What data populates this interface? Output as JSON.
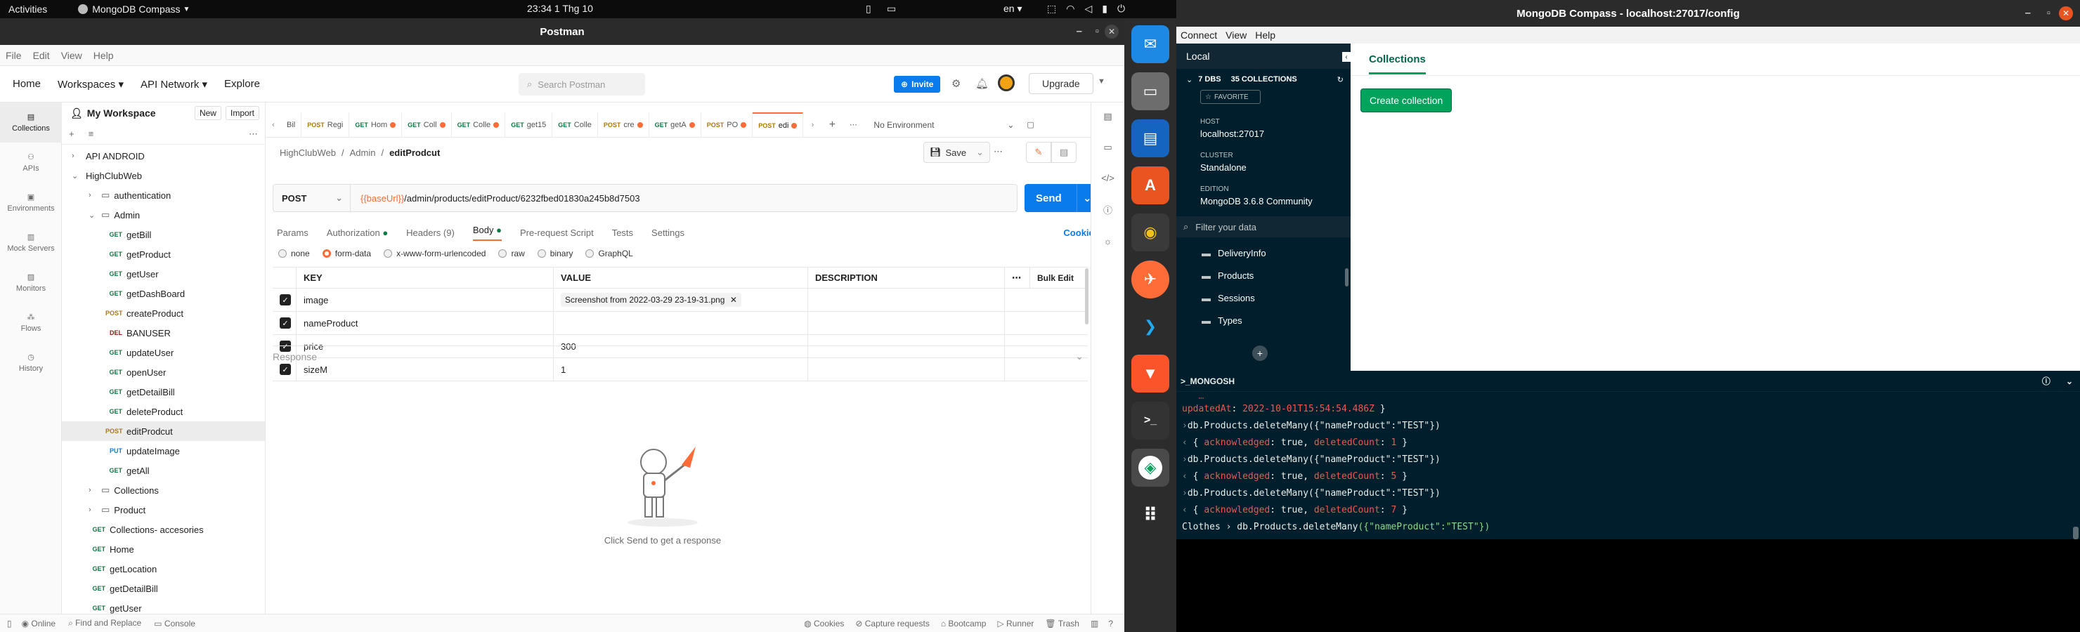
{
  "topbar": {
    "activities": "Activities",
    "app_menu": "MongoDB Compass",
    "clock": "23:34  1 Thg 10",
    "lang": "en"
  },
  "postman": {
    "window_title": "Postman",
    "menu": [
      "File",
      "Edit",
      "View",
      "Help"
    ],
    "header": {
      "home": "Home",
      "workspaces": "Workspaces",
      "api_network": "API Network",
      "explore": "Explore",
      "search_placeholder": "Search Postman",
      "invite": "Invite",
      "upgrade": "Upgrade"
    },
    "rail": [
      {
        "label": "Collections"
      },
      {
        "label": "APIs"
      },
      {
        "label": "Environments"
      },
      {
        "label": "Mock Servers"
      },
      {
        "label": "Monitors"
      },
      {
        "label": "Flows"
      },
      {
        "label": "History"
      }
    ],
    "workspace": {
      "title": "My Workspace",
      "new": "New",
      "import": "Import"
    },
    "tree": [
      {
        "level": 0,
        "type": "folder",
        "label": "API ANDROID"
      },
      {
        "level": 0,
        "type": "folder-open",
        "label": "HighClubWeb"
      },
      {
        "level": 1,
        "type": "folder",
        "label": "authentication"
      },
      {
        "level": 1,
        "type": "folder-open",
        "label": "Admin"
      },
      {
        "level": 2,
        "method": "GET",
        "label": "getBill"
      },
      {
        "level": 2,
        "method": "GET",
        "label": "getProduct"
      },
      {
        "level": 2,
        "method": "GET",
        "label": "getUser"
      },
      {
        "level": 2,
        "method": "GET",
        "label": "getDashBoard"
      },
      {
        "level": 2,
        "method": "POST",
        "label": "createProduct"
      },
      {
        "level": 2,
        "method": "DEL",
        "label": "BANUSER"
      },
      {
        "level": 2,
        "method": "GET",
        "label": "updateUser"
      },
      {
        "level": 2,
        "method": "GET",
        "label": "openUser"
      },
      {
        "level": 2,
        "method": "GET",
        "label": "getDetailBill"
      },
      {
        "level": 2,
        "method": "GET",
        "label": "deleteProduct"
      },
      {
        "level": 2,
        "method": "POST",
        "label": "editProdcut",
        "active": true
      },
      {
        "level": 2,
        "method": "PUT",
        "label": "updateImage"
      },
      {
        "level": 2,
        "method": "GET",
        "label": "getAll"
      },
      {
        "level": 1,
        "type": "folder",
        "label": "Collections"
      },
      {
        "level": 1,
        "type": "folder",
        "label": "Product"
      },
      {
        "level": 1,
        "method": "GET",
        "label": "Collections- accesories"
      },
      {
        "level": 1,
        "method": "GET",
        "label": "Home"
      },
      {
        "level": 1,
        "method": "GET",
        "label": "getLocation"
      },
      {
        "level": 1,
        "method": "GET",
        "label": "getDetailBill"
      },
      {
        "level": 1,
        "method": "GET",
        "label": "getUser"
      }
    ],
    "request_tabs": [
      {
        "method": "",
        "label": "Bil",
        "dot": false
      },
      {
        "method": "POST",
        "label": "Regi",
        "dot": false
      },
      {
        "method": "GET",
        "label": "Hom",
        "dot": true
      },
      {
        "method": "GET",
        "label": "Coll",
        "dot": true
      },
      {
        "method": "GET",
        "label": "Colle",
        "dot": true
      },
      {
        "method": "GET",
        "label": "get15",
        "dot": false
      },
      {
        "method": "GET",
        "label": "Colle",
        "dot": false
      },
      {
        "method": "POST",
        "label": "cre",
        "dot": true
      },
      {
        "method": "GET",
        "label": "getA",
        "dot": true
      },
      {
        "method": "POST",
        "label": "PO",
        "dot": true
      },
      {
        "method": "POST",
        "label": "edi",
        "dot": true,
        "active": true
      }
    ],
    "environment": "No Environment",
    "breadcrumb": {
      "a": "HighClubWeb",
      "b": "Admin",
      "c": "editProdcut"
    },
    "save": "Save",
    "request": {
      "method": "POST",
      "url_var": "{{baseUrl}}",
      "url_path": "/admin/products/editProduct/6232fbed01830a245b8d7503",
      "send": "Send",
      "cookies": "Cookies"
    },
    "subtabs": [
      {
        "label": "Params"
      },
      {
        "label": "Authorization"
      },
      {
        "label": "Headers (9)"
      },
      {
        "label": "Body",
        "active": true
      },
      {
        "label": "Pre-request Script"
      },
      {
        "label": "Tests"
      },
      {
        "label": "Settings"
      }
    ],
    "body_types": [
      {
        "label": "none"
      },
      {
        "label": "form-data",
        "on": true
      },
      {
        "label": "x-www-form-urlencoded"
      },
      {
        "label": "raw"
      },
      {
        "label": "binary"
      },
      {
        "label": "GraphQL"
      }
    ],
    "table": {
      "headers": [
        "KEY",
        "VALUE",
        "DESCRIPTION"
      ],
      "bulk_edit": "Bulk Edit",
      "rows": [
        {
          "key": "image",
          "value": "Screenshot from 2022-03-29 23-19-31.png",
          "file": true
        },
        {
          "key": "nameProduct",
          "value": ""
        },
        {
          "key": "price",
          "value": "300"
        },
        {
          "key": "sizeM",
          "value": "1"
        }
      ]
    },
    "response": {
      "label": "Response",
      "hint": "Click Send to get a response"
    },
    "status": {
      "online": "Online",
      "find": "Find and Replace",
      "console": "Console",
      "cookies": "Cookies",
      "capture": "Capture requests",
      "bootcamp": "Bootcamp",
      "runner": "Runner",
      "trash": "Trash"
    }
  },
  "compass": {
    "window_title": "MongoDB Compass - localhost:27017/config",
    "menu": [
      "Connect",
      "View",
      "Help"
    ],
    "local": "Local",
    "dbs": "7 DBS",
    "collections_count": "35 COLLECTIONS",
    "favorite": "FAVORITE",
    "host_label": "HOST",
    "host": "localhost:27017",
    "cluster_label": "CLUSTER",
    "cluster": "Standalone",
    "edition_label": "EDITION",
    "edition": "MongoDB 3.6.8 Community",
    "filter_placeholder": "Filter your data",
    "collections": [
      "DeliveryInfo",
      "Products",
      "Sessions",
      "Types"
    ],
    "main_tab": "Collections",
    "create": "Create collection",
    "shell_title": ">_MONGOSH",
    "shell": {
      "updated_key": "updatedAt",
      "updated_val": "2022-10-01T15:54:54.486Z",
      "cmd": "db.Products.deleteMany({\"nameProduct\":\"TEST\"})",
      "results": [
        {
          "ack": "true",
          "count": "1"
        },
        {
          "ack": "true",
          "count": "5"
        },
        {
          "ack": "true",
          "count": "7"
        }
      ],
      "prompt_db": "Clothes",
      "prompt_cmd": "db.Products.deleteMany",
      "prompt_args": "({\"nameProduct\":\"TEST\"})"
    }
  },
  "colors": {
    "postman_orange": "#ff6c37",
    "postman_blue": "#097bed",
    "mongo_green": "#00a35c",
    "mongo_dark": "#001e2b"
  }
}
